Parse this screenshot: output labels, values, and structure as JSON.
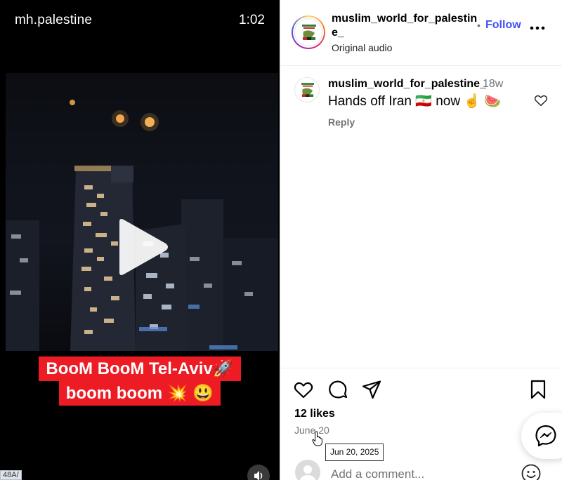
{
  "video": {
    "channel": "mh.palestine",
    "timestamp": "1:02",
    "caption_line1": "BooM BooM Tel-Aviv🚀",
    "caption_line2": "boom boom 💥 😃",
    "url_badge": "48A/"
  },
  "post": {
    "username": "muslim_world_for_palestine_",
    "audio": "Original audio",
    "dot": "•",
    "follow_label": "Follow",
    "comment": {
      "username": "muslim_world_for_palestine_",
      "time": "18w",
      "text": "Hands off Iran 🇮🇷 now ☝️ 🍉",
      "reply_label": "Reply"
    },
    "likes": "12 likes",
    "date": "June 20",
    "date_tooltip": "Jun 20, 2025",
    "add_comment_placeholder": "Add a comment..."
  },
  "colors": {
    "follow_blue": "#4150f7",
    "caption_red": "#ec1b24",
    "muted_gray": "#737373"
  },
  "icons": [
    "play-icon",
    "volume-icon",
    "more-icon",
    "heart-icon",
    "comment-icon",
    "share-icon",
    "bookmark-icon",
    "emoji-icon",
    "messenger-icon"
  ]
}
